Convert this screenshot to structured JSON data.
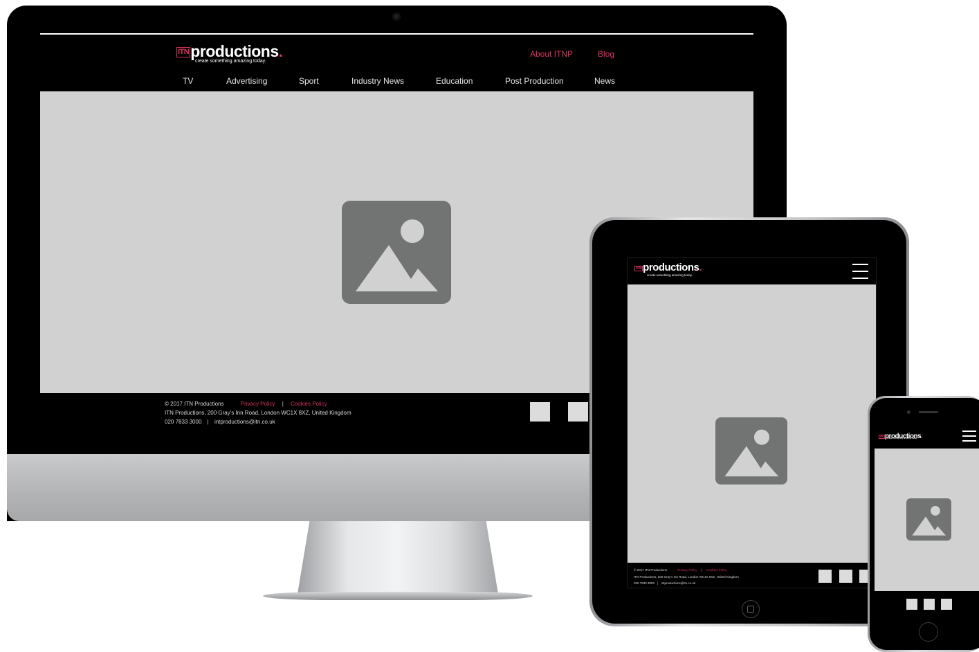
{
  "brand": {
    "logo_box": "ITN",
    "logo_word": "productions",
    "logo_dot": ".",
    "tagline": "create something amazing.today."
  },
  "desktop": {
    "top_links": [
      "About ITNP",
      "Blog"
    ],
    "nav": [
      "TV",
      "Advertising",
      "Sport",
      "Industry News",
      "Education",
      "Post Production",
      "News"
    ],
    "footer": {
      "copyright": "© 2017 ITN Productions",
      "privacy": "Privacy Policy",
      "separator": "|",
      "cookies": "Cookies Policy",
      "address": "ITN Productions, 200 Gray's Inn Road, London WC1X 8XZ, United Kingdom",
      "phone": "020 7833 3000",
      "email": "intproductions@itn.co.uk"
    }
  },
  "colors": {
    "accent": "#d8325f",
    "placeholder_bg": "#d0d1d0",
    "placeholder_icon": "#727474",
    "header_bg": "#000000"
  },
  "icons": {
    "hero": "image-placeholder-icon",
    "menu": "hamburger-menu-icon"
  }
}
